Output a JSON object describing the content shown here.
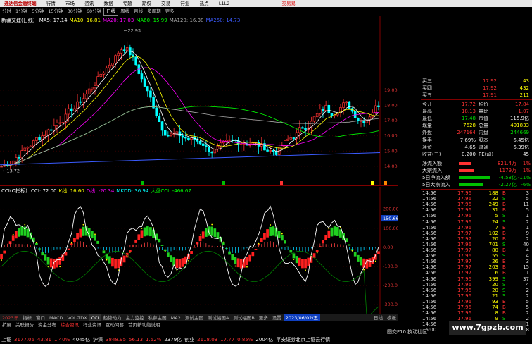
{
  "menubar": {
    "app_title": "通达信金融终端",
    "items": [
      "行情",
      "市场",
      "资讯",
      "数据",
      "专题",
      "期权",
      "交易",
      "行业",
      "热点",
      "L1L2"
    ],
    "trade_label": "交易易"
  },
  "toolbar": {
    "periods": [
      "分时",
      "1分钟",
      "5分钟",
      "15分钟",
      "30分钟",
      "60分钟",
      "日线",
      "周线",
      "月线",
      "多周期",
      "更多"
    ],
    "active": "日线"
  },
  "kline": {
    "title": "新疆交建(日线)",
    "ma": [
      {
        "label": "MA5: 17.14",
        "color": "#ffffff"
      },
      {
        "label": "MA10: 16.81",
        "color": "#ffff00"
      },
      {
        "label": "MA20: 17.03",
        "color": "#ff00ff"
      },
      {
        "label": "MA60: 15.99",
        "color": "#00ff00"
      },
      {
        "label": "MA120: 16.38",
        "color": "#aaaaaa"
      },
      {
        "label": "MA250: 14.73",
        "color": "#3b5bff"
      }
    ],
    "high_label": "22.93",
    "low_label": "13.72",
    "yticks": [
      "19.00",
      "18.00",
      "17.00",
      "16.00",
      "15.00",
      "14.00"
    ]
  },
  "sub": {
    "name": "CCI(O指标)",
    "labels": [
      {
        "t": "CCI: 72.00",
        "c": "#ffffff"
      },
      {
        "t": "K线: 16.60",
        "c": "#ffff00"
      },
      {
        "t": "D线: -20.34",
        "c": "#ff00ff"
      },
      {
        "t": "MKDD: 36.94",
        "c": "#00ffff"
      },
      {
        "t": "大盘CCI: -466.67",
        "c": "#00ff00"
      }
    ],
    "current": "150.66",
    "yticks": [
      "200.00",
      "100.00",
      "0.00",
      "-100.00",
      "-200.00",
      "-300.00"
    ]
  },
  "date_axis": {
    "start": "2023年",
    "highlight": "2023/06/02/五",
    "ticks": [
      "2",
      "3",
      "4",
      "5",
      "6",
      "7",
      "8",
      "9"
    ]
  },
  "bottom_tabs": [
    "指标",
    "窗口",
    "MACD",
    "VOL-TDX",
    "CCI",
    "趋势动力",
    "主力监控",
    "私募主图",
    "MA2",
    "测试主图",
    "测试幅图A",
    "测试幅图B",
    "更多",
    "设置"
  ],
  "bottom_tabs_active": "CCI",
  "bottom_right": {
    "mode": "模板",
    "period": "日线"
  },
  "func_tabs": [
    "扩展",
    "关联报价",
    "资金分布",
    "综合资讯",
    "行业资讯",
    "互动问答",
    "首页新功能说明"
  ],
  "right_panel": {
    "order_book": [
      {
        "label": "买三",
        "price": "17.92",
        "vol": "43"
      },
      {
        "label": "买四",
        "price": "17.92",
        "vol": "432"
      },
      {
        "label": "买五",
        "price": "17.91",
        "vol": "211"
      }
    ],
    "quote": [
      {
        "l1": "今开",
        "v1": "17.72",
        "c1": "red",
        "l2": "均价",
        "v2": "17.84",
        "c2": "red"
      },
      {
        "l1": "最高",
        "v1": "18.13",
        "c1": "red",
        "l2": "量比",
        "v2": "1.07",
        "c2": "red"
      },
      {
        "l1": "最低",
        "v1": "17.48",
        "c1": "green",
        "l2": "市值",
        "v2": "115.9亿",
        "c2": "white"
      },
      {
        "l1": "现量",
        "v1": "7628",
        "c1": "yellow",
        "l2": "总量",
        "v2": "491833",
        "c2": "yellow"
      },
      {
        "l1": "外盘",
        "v1": "247164",
        "c1": "red",
        "l2": "内盘",
        "v2": "244669",
        "c2": "green"
      }
    ],
    "stats": [
      {
        "l1": "换手",
        "v1": "7.69%",
        "c1": "white",
        "l2": "股本",
        "v2": "6.45亿",
        "c2": "white"
      },
      {
        "l1": "净资",
        "v1": "4.65",
        "c1": "white",
        "l2": "流通",
        "v2": "6.39亿",
        "c2": "white"
      },
      {
        "l1": "收益(三)",
        "v1": "0.200",
        "c1": "white",
        "l2": "PE(动)",
        "v2": "45",
        "c2": "white"
      }
    ],
    "flow": [
      {
        "label": "净流入额",
        "value": "821.4万",
        "pct": "1%",
        "bar": "#ff3232",
        "w": 18
      },
      {
        "label": "大宗流入",
        "value": "1179万",
        "pct": "1%",
        "bar": "#ff3232",
        "w": 22
      },
      {
        "label": "5日净流入额",
        "value": "-4.58亿",
        "pct": "-11%",
        "bar": "#00c000",
        "w": 44
      },
      {
        "label": "5日大宗流入",
        "value": "-2.27亿",
        "pct": "-6%",
        "bar": "#00c000",
        "w": 34
      }
    ],
    "ticks": [
      {
        "t": "14:56",
        "p": "17.96",
        "v": "188",
        "s": "B",
        "n": "3"
      },
      {
        "t": "14:56",
        "p": "17.96",
        "v": "22",
        "s": "S",
        "n": "5"
      },
      {
        "t": "14:56",
        "p": "17.96",
        "v": "249",
        "s": "B",
        "n": "11"
      },
      {
        "t": "14:56",
        "p": "17.96",
        "v": "31",
        "s": "B",
        "n": "5"
      },
      {
        "t": "14:56",
        "p": "17.96",
        "v": "5",
        "s": "S",
        "n": "1"
      },
      {
        "t": "14:56",
        "p": "17.96",
        "v": "24",
        "s": "S",
        "n": "2"
      },
      {
        "t": "14:56",
        "p": "17.96",
        "v": "7",
        "s": "B",
        "n": "1"
      },
      {
        "t": "14:56",
        "p": "17.97",
        "v": "102",
        "s": "B",
        "n": "9"
      },
      {
        "t": "14:56",
        "p": "17.97",
        "v": "20",
        "s": "B",
        "n": "2"
      },
      {
        "t": "14:56",
        "p": "17.96",
        "v": "701",
        "s": "S",
        "n": "40"
      },
      {
        "t": "14:56",
        "p": "17.97",
        "v": "80",
        "s": "B",
        "n": "4"
      },
      {
        "t": "14:56",
        "p": "17.96",
        "v": "55",
        "s": "S",
        "n": "4"
      },
      {
        "t": "14:56",
        "p": "17.97",
        "v": "26",
        "s": "B",
        "n": "3"
      },
      {
        "t": "14:56",
        "p": "17.97",
        "v": "203",
        "s": "B",
        "n": "15"
      },
      {
        "t": "14:56",
        "p": "17.97",
        "v": "6",
        "s": "B",
        "n": "1"
      },
      {
        "t": "14:56",
        "p": "17.96",
        "v": "399",
        "s": "S",
        "n": "37"
      },
      {
        "t": "14:56",
        "p": "17.96",
        "v": "20",
        "s": "S",
        "n": "4"
      },
      {
        "t": "14:56",
        "p": "17.96",
        "v": "20",
        "s": "S",
        "n": "2"
      },
      {
        "t": "14:56",
        "p": "17.96",
        "v": "21",
        "s": "S",
        "n": "2"
      },
      {
        "t": "14:56",
        "p": "17.96",
        "v": "93",
        "s": "B",
        "n": "5"
      },
      {
        "t": "14:56",
        "p": "17.96",
        "v": "74",
        "s": "B",
        "n": "5"
      },
      {
        "t": "14:56",
        "p": "17.96",
        "v": "8",
        "s": "B",
        "n": "2"
      },
      {
        "t": "14:56",
        "p": "17.96",
        "v": "9",
        "s": "S",
        "n": "2"
      },
      {
        "t": "14:56",
        "p": "17.96",
        "v": "110",
        "s": "S",
        "n": "11"
      },
      {
        "t": "15:00",
        "p": "17.96",
        "v": "4313",
        "s": "",
        "n": "348"
      }
    ],
    "footer": "图交F10  执动社区"
  },
  "statusbar": {
    "items": [
      {
        "t": "上证",
        "c": "white"
      },
      {
        "t": "3177.06",
        "c": "red"
      },
      {
        "t": "43.81",
        "c": "red"
      },
      {
        "t": "1.40%",
        "c": "red"
      },
      {
        "t": "4045亿",
        "c": "white"
      },
      {
        "t": "沪深",
        "c": "white"
      },
      {
        "t": "3848.95",
        "c": "red"
      },
      {
        "t": "56.13",
        "c": "red"
      },
      {
        "t": "1.52%",
        "c": "red"
      },
      {
        "t": "2379亿",
        "c": "white"
      },
      {
        "t": "创业",
        "c": "white"
      },
      {
        "t": "2118.03",
        "c": "red"
      },
      {
        "t": "17.77",
        "c": "red"
      },
      {
        "t": "0.85%",
        "c": "red"
      },
      {
        "t": "2004亿",
        "c": "white"
      },
      {
        "t": "平安证券北京上证云行情",
        "c": "white"
      }
    ]
  },
  "watermark": "www.7gpzb.com"
}
